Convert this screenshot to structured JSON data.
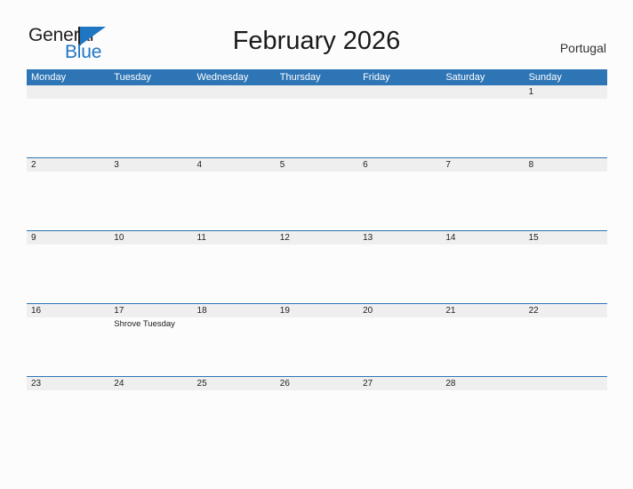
{
  "brand": {
    "name_part1": "General",
    "name_part2": "Blue",
    "flag_icon": "flag-triangle-icon",
    "primary_color": "#1f77c4"
  },
  "header": {
    "title": "February 2026",
    "region": "Portugal"
  },
  "colors": {
    "header_blue": "#2e75b6",
    "date_band_gray": "#efefef",
    "separator_blue": "#2e75b6",
    "page_background": "#fcfcfc"
  },
  "calendar": {
    "month": "February",
    "year": "2026",
    "weekday_headers": [
      "Monday",
      "Tuesday",
      "Wednesday",
      "Thursday",
      "Friday",
      "Saturday",
      "Sunday"
    ],
    "weeks": [
      {
        "days": [
          {
            "date": "",
            "events": []
          },
          {
            "date": "",
            "events": []
          },
          {
            "date": "",
            "events": []
          },
          {
            "date": "",
            "events": []
          },
          {
            "date": "",
            "events": []
          },
          {
            "date": "",
            "events": []
          },
          {
            "date": "1",
            "events": []
          }
        ]
      },
      {
        "days": [
          {
            "date": "2",
            "events": []
          },
          {
            "date": "3",
            "events": []
          },
          {
            "date": "4",
            "events": []
          },
          {
            "date": "5",
            "events": []
          },
          {
            "date": "6",
            "events": []
          },
          {
            "date": "7",
            "events": []
          },
          {
            "date": "8",
            "events": []
          }
        ]
      },
      {
        "days": [
          {
            "date": "9",
            "events": []
          },
          {
            "date": "10",
            "events": []
          },
          {
            "date": "11",
            "events": []
          },
          {
            "date": "12",
            "events": []
          },
          {
            "date": "13",
            "events": []
          },
          {
            "date": "14",
            "events": []
          },
          {
            "date": "15",
            "events": []
          }
        ]
      },
      {
        "days": [
          {
            "date": "16",
            "events": []
          },
          {
            "date": "17",
            "events": [
              "Shrove Tuesday"
            ]
          },
          {
            "date": "18",
            "events": []
          },
          {
            "date": "19",
            "events": []
          },
          {
            "date": "20",
            "events": []
          },
          {
            "date": "21",
            "events": []
          },
          {
            "date": "22",
            "events": []
          }
        ]
      },
      {
        "days": [
          {
            "date": "23",
            "events": []
          },
          {
            "date": "24",
            "events": []
          },
          {
            "date": "25",
            "events": []
          },
          {
            "date": "26",
            "events": []
          },
          {
            "date": "27",
            "events": []
          },
          {
            "date": "28",
            "events": []
          },
          {
            "date": "",
            "events": []
          }
        ]
      }
    ]
  }
}
